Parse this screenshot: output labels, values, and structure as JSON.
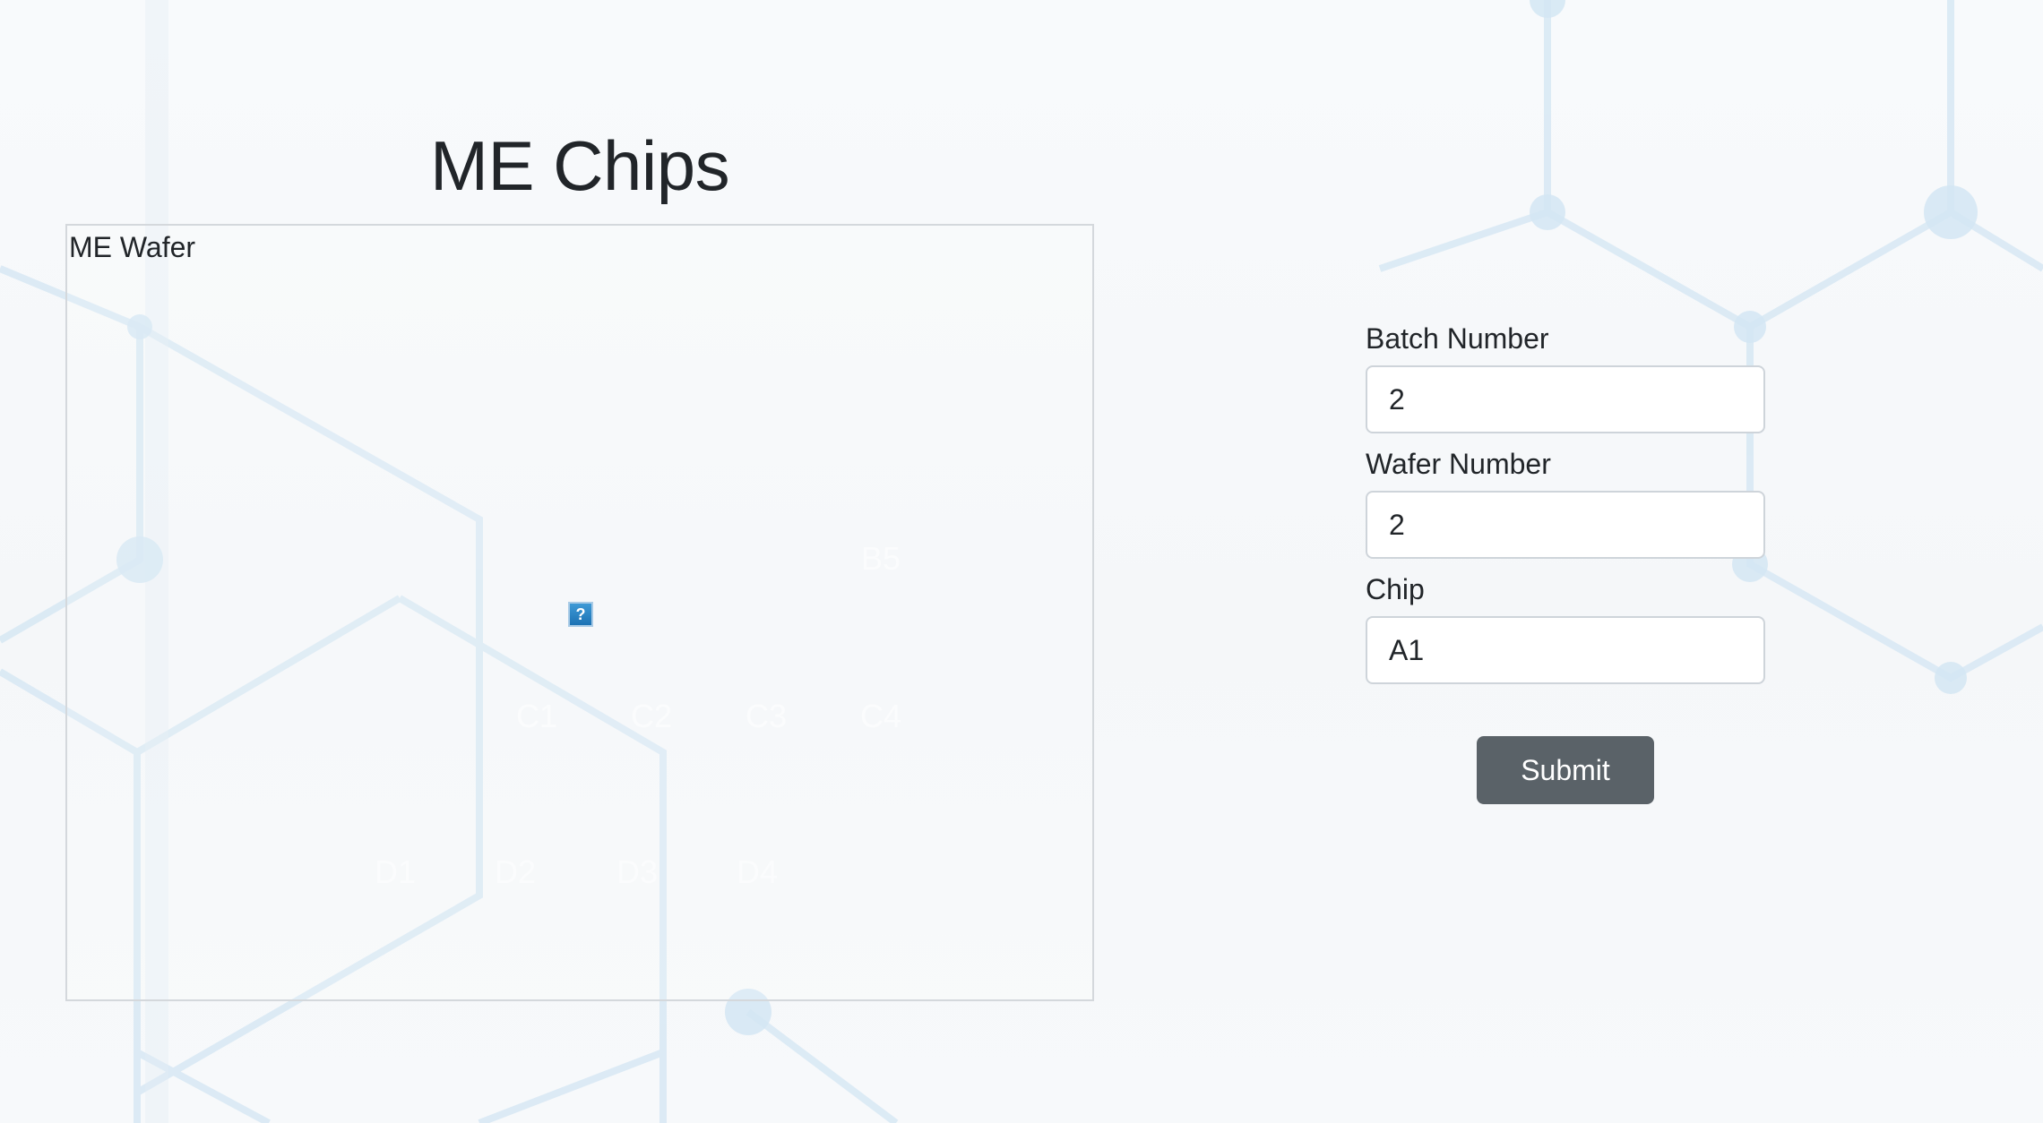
{
  "page": {
    "title": "ME Chips"
  },
  "wafer": {
    "caption": "ME Wafer",
    "image_icon": "broken-image-icon",
    "chips": [
      {
        "label": "B5"
      },
      {
        "label": "C1"
      },
      {
        "label": "C2"
      },
      {
        "label": "C3"
      },
      {
        "label": "C4"
      },
      {
        "label": "D1"
      },
      {
        "label": "D2"
      },
      {
        "label": "D3"
      },
      {
        "label": "D4"
      }
    ]
  },
  "form": {
    "batch": {
      "label": "Batch Number",
      "value": "2"
    },
    "wafer": {
      "label": "Wafer Number",
      "value": "2"
    },
    "chip": {
      "label": "Chip",
      "value": "A1"
    },
    "submit_label": "Submit"
  },
  "colors": {
    "button": "#5a6268",
    "hex_network": "#cfe3f2",
    "border": "#ced4da"
  }
}
